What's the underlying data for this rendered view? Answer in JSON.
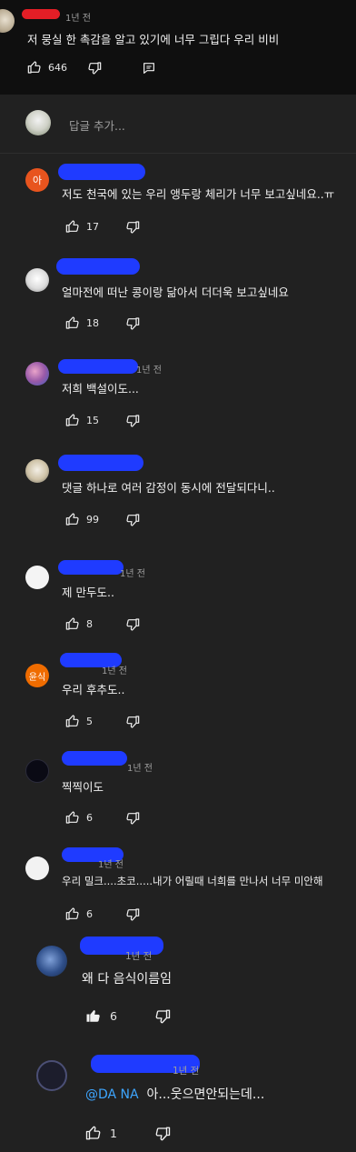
{
  "top_comment": {
    "author_meta": "1년 전",
    "text": "저 뭉실 한 촉감을 알고 있기에 너무 그립다 우리 비비",
    "likes": "646"
  },
  "reply_box": {
    "placeholder": "답글 추가..."
  },
  "replies": [
    {
      "avatar_text": "아",
      "avatar_color": "#e8541e",
      "text": "저도 천국에 있는 우리 앵두랑 체리가 너무 보고싶네요..ㅠ",
      "likes": "17"
    },
    {
      "text": "얼마전에 떠난 콩이랑 닮아서 더더욱 보고싶네요",
      "likes": "18"
    },
    {
      "meta": "1년 전",
      "text": "저희 백설이도...",
      "likes": "15"
    },
    {
      "text": "댓글 하나로 여러 감정이 동시에 전달되다니..",
      "likes": "99"
    },
    {
      "meta": "1년 전",
      "text": "제 만두도..",
      "likes": "8"
    },
    {
      "avatar_text": "윤식",
      "avatar_color": "#ef6c00",
      "meta": "1년 전",
      "text": "우리 후추도..",
      "likes": "5"
    },
    {
      "meta": "1년 전",
      "text": "찍찍이도",
      "likes": "6"
    },
    {
      "meta": "1년 전",
      "text": "우리 밀크....초코.....내가 어릴때 너희를 만나서 너무 미안해",
      "likes": "6"
    },
    {
      "meta": "1년 전",
      "text": "왜 다 음식이름임",
      "likes": "6"
    },
    {
      "meta": "1년 전",
      "mention": "@DA NA",
      "text": "아...웃으면안되는데...",
      "likes": "1"
    }
  ],
  "colors": {
    "background": "#212121",
    "top_background": "#0f0f0f",
    "scribble_blue": "#1f3bff",
    "scribble_red": "#e41e26",
    "mention": "#3ea6ff"
  }
}
